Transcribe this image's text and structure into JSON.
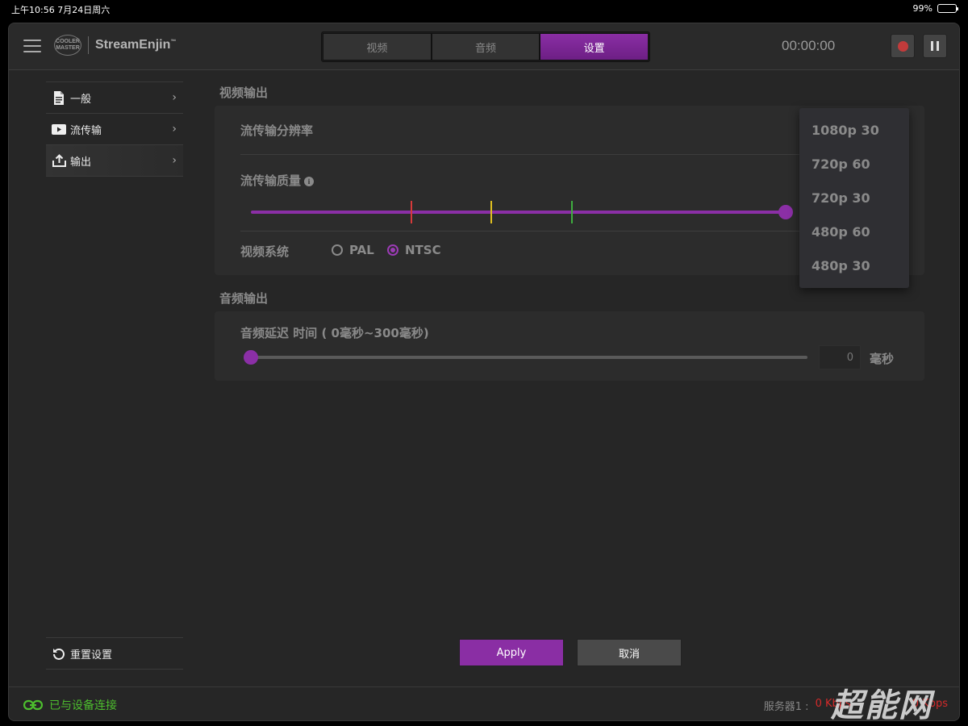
{
  "status_bar": {
    "time_date": "上午10:56   7月24日周六",
    "battery": "99%"
  },
  "header": {
    "logo_badge": "COOLER\nMASTER",
    "app_name": "StreamEnjin",
    "trademark": "™",
    "tabs": [
      {
        "label": "视频",
        "active": false
      },
      {
        "label": "音频",
        "active": false
      },
      {
        "label": "设置",
        "active": true
      }
    ],
    "timer": "00:00:00"
  },
  "sidebar": {
    "items": [
      {
        "label": "一般",
        "icon": "document-icon"
      },
      {
        "label": "流传输",
        "icon": "play-icon"
      },
      {
        "label": "输出",
        "icon": "upload-icon",
        "active": true
      }
    ],
    "reset_label": "重置设置"
  },
  "video_output": {
    "section_title": "视频输出",
    "resolution_label": "流传输分辨率",
    "quality_label": "流传输质量",
    "quality_level": 1.0,
    "system_label": "视频系统",
    "system_options": [
      "PAL",
      "NTSC"
    ],
    "system_selected": "NTSC",
    "resolution_options": [
      "1080p 30",
      "720p 60",
      "720p 30",
      "480p 60",
      "480p 30"
    ]
  },
  "audio_output": {
    "section_title": "音频输出",
    "delay_label": "音频延迟 时间 ( 0毫秒~300毫秒)",
    "delay_value": "0",
    "delay_unit": "毫秒"
  },
  "actions": {
    "apply_label": "Apply",
    "cancel_label": "取消"
  },
  "footer": {
    "connection_status": "已与设备连接",
    "server1_label": "服务器1 :",
    "server1_value": "0 Kbps",
    "server2_value": "0 Kbps"
  },
  "watermark": "超能网",
  "colors": {
    "accent": "#8a2ea4",
    "connected": "#4dbe2e",
    "rate": "#d62a2a",
    "tick_red": "#d63a3a",
    "tick_yellow": "#e0c020",
    "tick_green": "#3fae3f"
  }
}
